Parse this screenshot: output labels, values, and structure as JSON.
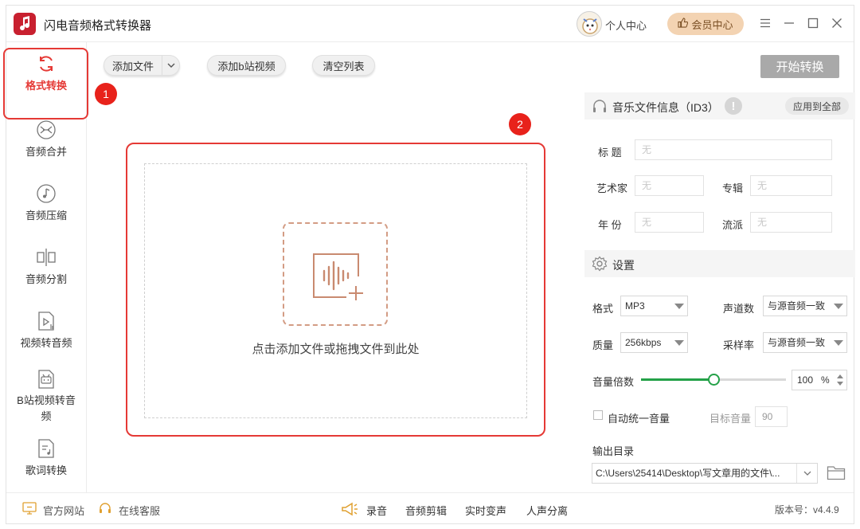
{
  "app": {
    "title": "闪电音频格式转换器"
  },
  "header": {
    "personal_center": "个人中心",
    "vip_center": "会员中心"
  },
  "sidebar": {
    "items": [
      {
        "label": "格式转换",
        "icon": "refresh-cycle-icon",
        "active": true
      },
      {
        "label": "音频合并",
        "icon": "merge-arrows-icon"
      },
      {
        "label": "音频压缩",
        "icon": "music-note-icon"
      },
      {
        "label": "音频分割",
        "icon": "split-icon"
      },
      {
        "label": "视频转音频",
        "icon": "video-file-icon"
      },
      {
        "label": "B站视频转音频",
        "icon": "bilibili-tv-icon"
      },
      {
        "label": "歌词转换",
        "icon": "lyrics-file-icon"
      }
    ]
  },
  "annotations": {
    "badge1": "1",
    "badge2": "2"
  },
  "toolbar": {
    "add_file": "添加文件",
    "add_bilibili": "添加b站视频",
    "clear_list": "清空列表",
    "start": "开始转换"
  },
  "dropzone": {
    "hint": "点击添加文件或拖拽文件到此处"
  },
  "id3": {
    "header": "音乐文件信息（ID3）",
    "apply_all": "应用到全部",
    "title_label": "标  题",
    "artist_label": "艺术家",
    "album_label": "专辑",
    "year_label": "年  份",
    "genre_label": "流派",
    "empty": "无"
  },
  "settings": {
    "header": "设置",
    "format_label": "格式",
    "format_value": "MP3",
    "channels_label": "声道数",
    "channels_value": "与源音频一致",
    "quality_label": "质量",
    "quality_value": "256kbps",
    "samplerate_label": "采样率",
    "samplerate_value": "与源音频一致",
    "volume_label": "音量倍数",
    "volume_value": "100",
    "volume_unit": "%",
    "volume_fraction": 0.5,
    "auto_volume_label": "自动统一音量",
    "target_volume_label": "目标音量",
    "target_volume_value": "90",
    "output_label": "输出目录",
    "output_path": "C:\\Users\\25414\\Desktop\\写文章用的文件\\..."
  },
  "bottom": {
    "website": "官方网站",
    "service": "在线客服",
    "record": "录音",
    "cut": "音频剪辑",
    "voice_change": "实时变声",
    "vocal_sep": "人声分离",
    "version": "版本号：v4.4.9"
  },
  "colors": {
    "accent_red": "#e53935",
    "logo_red": "#c8202f",
    "slider_green": "#24a148",
    "vip_bg": "#f3d3b2"
  }
}
